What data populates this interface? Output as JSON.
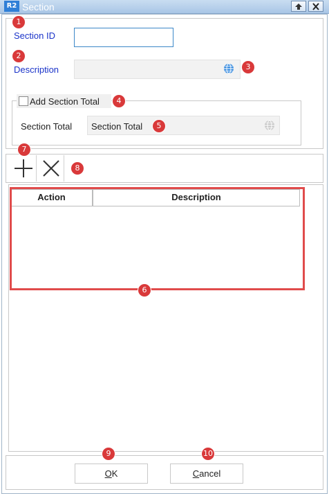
{
  "window": {
    "app_icon_text": "R2",
    "title": "Section"
  },
  "form": {
    "section_id_label": "Section ID",
    "section_id_value": "",
    "description_label": "Description",
    "description_value": "",
    "add_section_total_label": "Add Section Total",
    "add_section_total_checked": false,
    "section_total_label": "Section Total",
    "section_total_value": "Section Total"
  },
  "grid": {
    "columns": [
      "Action",
      "Description"
    ],
    "rows": []
  },
  "buttons": {
    "ok_mnemonic": "O",
    "ok_rest": "K",
    "cancel_mnemonic": "C",
    "cancel_rest": "ancel"
  },
  "badges": [
    "1",
    "2",
    "3",
    "4",
    "5",
    "6",
    "7",
    "8",
    "9",
    "10"
  ],
  "colors": {
    "label_blue": "#1a33c9",
    "badge_red": "#d9393a",
    "highlight_red": "#e04b4b",
    "input_border": "#3b87c8"
  }
}
